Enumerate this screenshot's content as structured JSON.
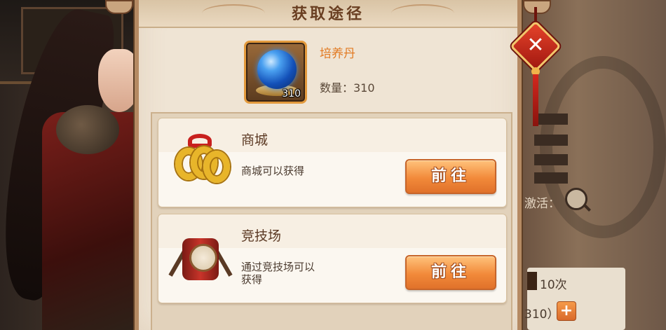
{
  "dialog": {
    "title": "获取途径",
    "close_icon": "close-icon",
    "close_glyph": "✕"
  },
  "item": {
    "name": "培养丹",
    "quantity_label": "数量：310",
    "badge_count": "310",
    "icon": "blue-orb-icon"
  },
  "sources": [
    {
      "title": "商城",
      "description": "商城可以获得",
      "button_label": "前往",
      "icon": "golden-rings-icon"
    },
    {
      "title": "竞技场",
      "description": "通过竞技场可以获得",
      "button_label": "前往",
      "icon": "drum-icon"
    }
  ],
  "background": {
    "activate_label": "激活：",
    "times_label": "10次",
    "count_fragment": "310）",
    "plus_glyph": "+"
  },
  "colors": {
    "accent": "#f28a3a",
    "item_name": "#e27a22",
    "close": "#c82a1c"
  }
}
